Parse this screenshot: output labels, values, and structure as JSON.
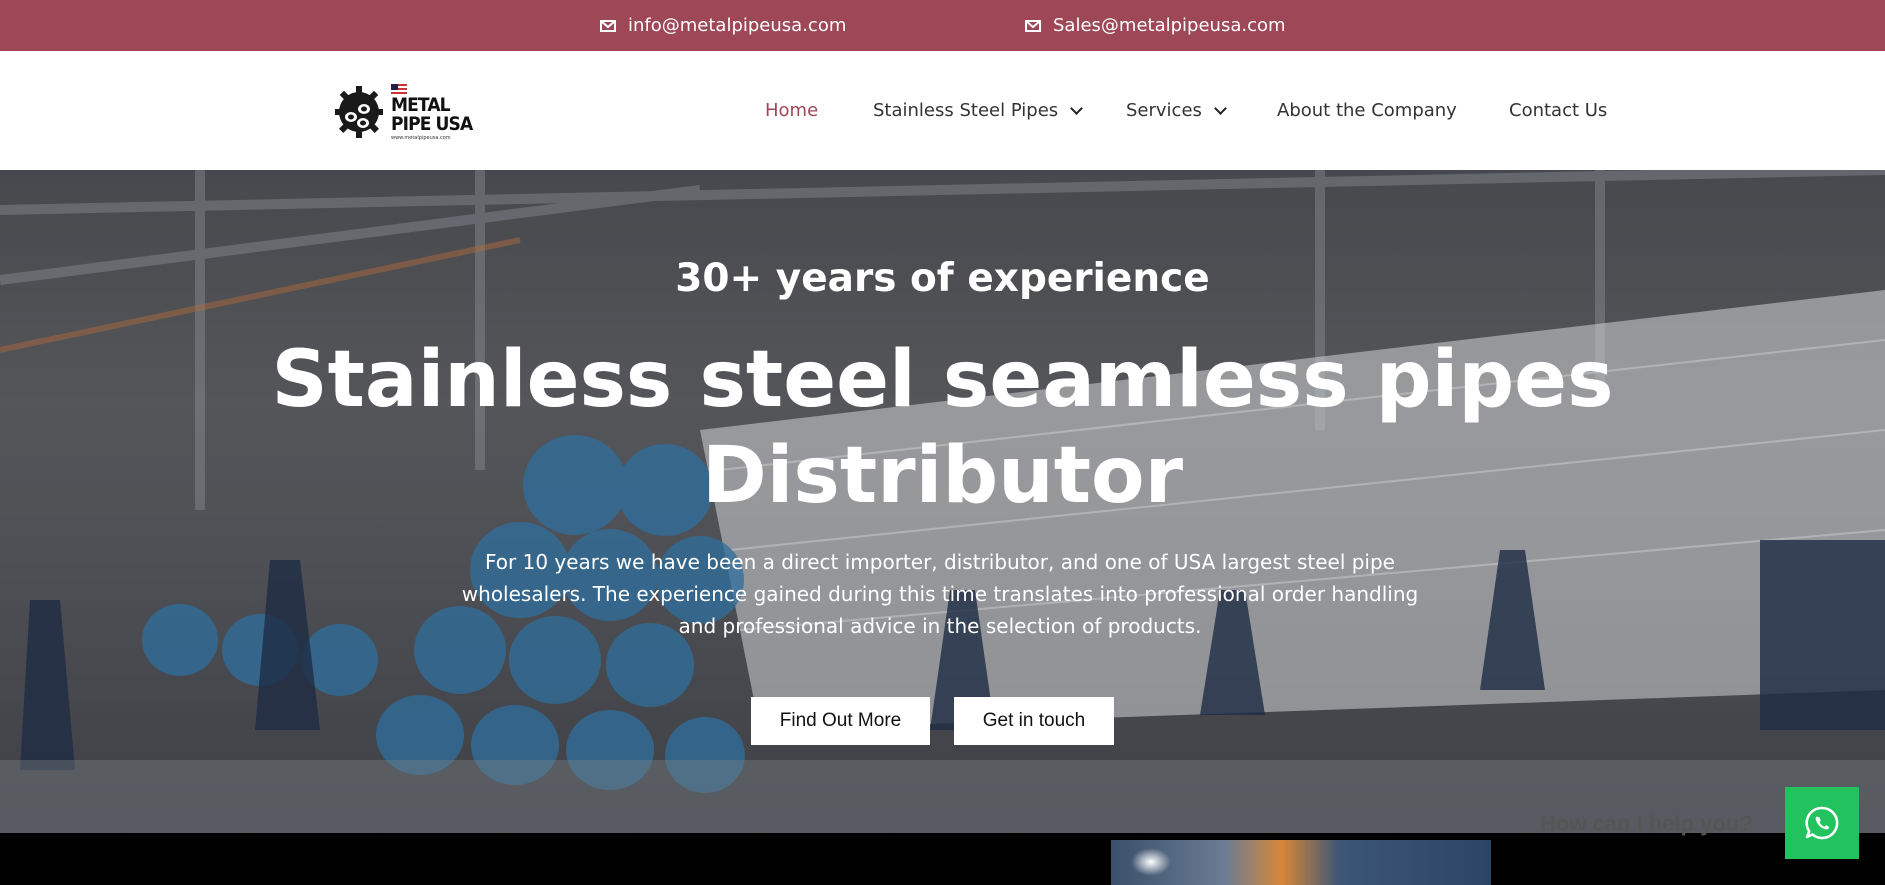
{
  "colors": {
    "accent": "#9e4757",
    "chat": "#22c35e"
  },
  "topbar": {
    "contacts": [
      {
        "icon": "envelope-icon",
        "label": "info@metalpipeusa.com"
      },
      {
        "icon": "envelope-icon",
        "label": "Sales@metalpipeusa.com"
      }
    ]
  },
  "header": {
    "logo": {
      "line1": "METAL",
      "line2": "PIPE USA",
      "url": "www.metalpipeusa.com"
    },
    "nav": [
      {
        "label": "Home",
        "active": true
      },
      {
        "label": "Stainless Steel Pipes",
        "dropdown": true
      },
      {
        "label": "Services",
        "dropdown": true
      },
      {
        "label": "About the Company"
      },
      {
        "label": "Contact Us"
      }
    ]
  },
  "hero": {
    "subtitle": "30+ years of experience",
    "title_line1": "Stainless steel seamless pipes",
    "title_line2": "Distributor",
    "description": "For 10 years we have been a direct importer, distributor, and one of USA largest steel pipe wholesalers. The experience gained during this time translates into professional order handling and professional advice in the selection of products.",
    "buttons": [
      "Find Out More",
      "Get in touch"
    ]
  },
  "chat": {
    "prompt": "How can I help you?",
    "icon": "whatsapp-icon"
  }
}
